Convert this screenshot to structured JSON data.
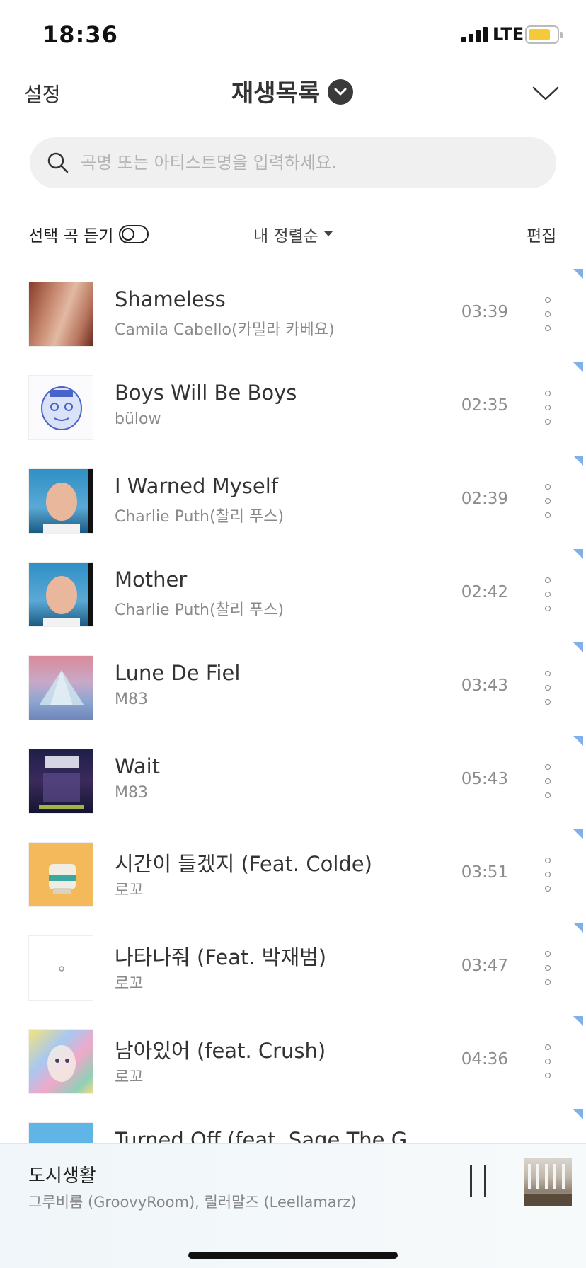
{
  "status_bar": {
    "time": "18:36",
    "network": "LTE"
  },
  "header": {
    "settings": "설정",
    "title": "재생목록"
  },
  "search": {
    "placeholder": "곡명 또는 아티스트명을 입력하세요."
  },
  "toolbar": {
    "select_listen": "선택 곡 듣기",
    "sort": "내 정렬순",
    "edit": "편집"
  },
  "tracks": [
    {
      "title": "Shameless",
      "artist": "Camila Cabello(카밀라 카베요)",
      "duration": "03:39"
    },
    {
      "title": "Boys Will Be Boys",
      "artist": "bülow",
      "duration": "02:35"
    },
    {
      "title": "I Warned Myself",
      "artist": "Charlie Puth(찰리 푸스)",
      "duration": "02:39"
    },
    {
      "title": "Mother",
      "artist": "Charlie Puth(찰리 푸스)",
      "duration": "02:42"
    },
    {
      "title": "Lune De Fiel",
      "artist": "M83",
      "duration": "03:43"
    },
    {
      "title": "Wait",
      "artist": "M83",
      "duration": "05:43"
    },
    {
      "title": "시간이 들겠지 (Feat. Colde)",
      "artist": "로꼬",
      "duration": "03:51"
    },
    {
      "title": "나타나줘 (Feat. 박재범)",
      "artist": "로꼬",
      "duration": "03:47"
    },
    {
      "title": "남아있어 (feat. Crush)",
      "artist": "로꼬",
      "duration": "04:36"
    },
    {
      "title": "Turned Off (feat. Sage The Gemini)",
      "artist": "",
      "duration": ""
    }
  ],
  "now_playing": {
    "title": "도시생활",
    "artist": "그루비룸 (GroovyRoom), 릴러말즈 (Leellamarz)"
  },
  "colors": {
    "accent_marker": "#7fb0ea",
    "battery": "#f4c93a"
  },
  "icons": {
    "search": "search-icon",
    "collapse": "chevron-down-icon",
    "more": "more-vertical-icon",
    "pause": "pause-icon"
  }
}
